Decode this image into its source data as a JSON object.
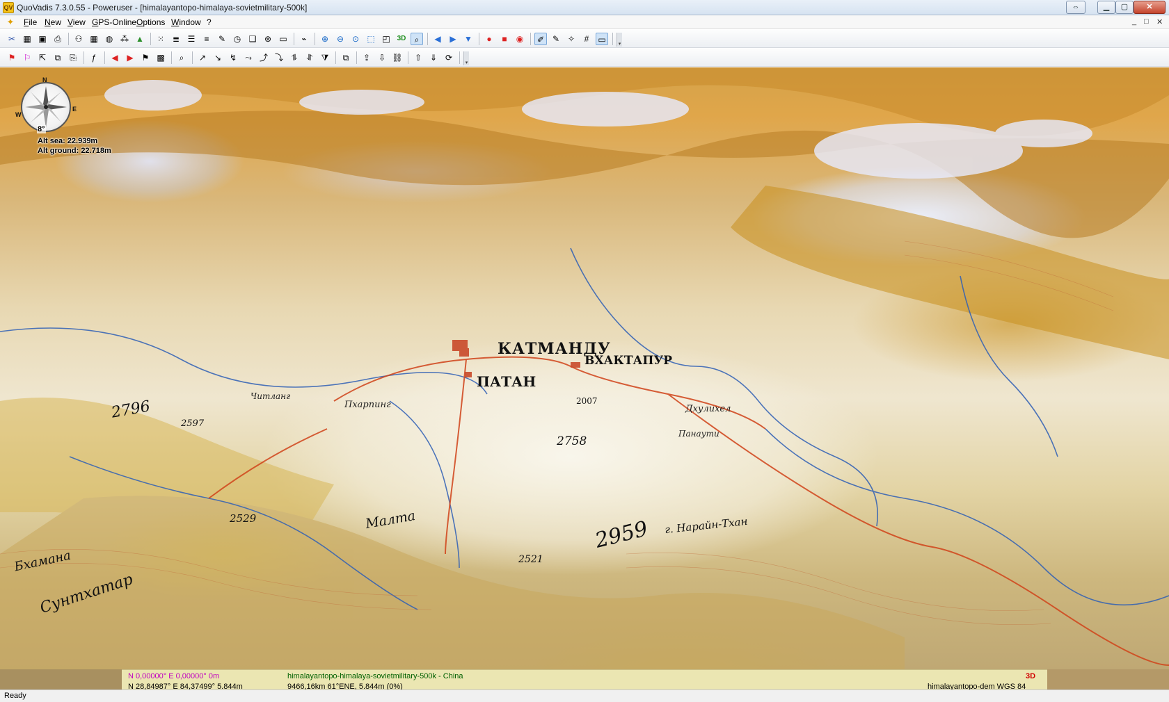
{
  "window": {
    "app_icon": "quovadis-app-icon",
    "title": "QuoVadis 7.3.0.55 - Poweruser - [himalayantopo-himalaya-sovietmilitary-500k]",
    "controls": [
      "restore-alt-icon",
      "minimize-icon",
      "maximize-icon",
      "close-icon"
    ]
  },
  "menubar": {
    "items": [
      "File",
      "New",
      "View",
      "GPS-Online",
      "Options",
      "Window",
      "?"
    ],
    "mdi_controls": [
      "_",
      "□",
      "✕"
    ]
  },
  "toolbar": {
    "row1_icons": [
      "tools-icon",
      "open-map-icon",
      "save-icon",
      "print-icon",
      "binoculars-icon",
      "grid-icon",
      "globe-icon",
      "waypoints-icon",
      "mountain-icon",
      "dots-icon",
      "layers-icon",
      "route-list-icon",
      "track-list-icon",
      "waypoint-edit-icon",
      "clock-icon",
      "book-icon",
      "satellite-icon",
      "ruler-icon",
      "gps-icon",
      "zoom-in-icon",
      "zoom-out-icon",
      "zoom-fit-icon",
      "zoom-rect-icon",
      "3d-view-icon",
      "3d-label-icon",
      "zoom-selected-icon",
      "back-icon",
      "forward-icon",
      "down-icon",
      "record-icon",
      "record-stop-icon",
      "record-pause-icon",
      "draw-icon",
      "pencil-icon",
      "compass-tool-icon",
      "grid-toggle-icon",
      "frame-icon"
    ],
    "row2_icons": [
      "waypoint-new-icon",
      "waypoint-delete-icon",
      "waypoint-move-icon",
      "waypoint-copy-icon",
      "waypoint-paste-icon",
      "script-icon",
      "arrow-left-red-icon",
      "arrow-right-red-icon",
      "flag-icon",
      "color-icon",
      "search-icon",
      "route-add-icon",
      "route-remove-icon",
      "route-split-icon",
      "route-join-icon",
      "track-add-icon",
      "track-remove-icon",
      "track-split-icon",
      "track-join-icon",
      "filter-icon",
      "copy-layer-icon",
      "export-icon",
      "import-icon",
      "link-icon",
      "gps-upload-icon",
      "gps-download-icon",
      "gps-sync-icon"
    ],
    "label_3d": "3D"
  },
  "map": {
    "compass": {
      "n": "N",
      "e": "E",
      "w": "W",
      "heading": "8°"
    },
    "alt_sea": "Alt sea: 22.939m",
    "alt_ground": "Alt ground: 22.718m",
    "labels": {
      "city_main": "КАТМАНДУ",
      "city_patan": "ПАТАН",
      "city_bhaktapur": "ВХАКТАПУР",
      "elev_2758": "2758",
      "elev_2959": "2959",
      "place_marka": "Малта",
      "place_narain": "г. Нарайн-Тхан",
      "place_pharping": "Пхарпинг",
      "place_chitlang": "Читланг",
      "place_dhulikhel": "Дхулихел",
      "place_panauti": "Панаути",
      "place_sukhbatar": "Сунтхатар",
      "place_bakhnia": "Бхамана",
      "elev_2529": "2529",
      "elev_2597": "2597",
      "elev_2007": "2007",
      "elev_2521": "2521",
      "elev_2796": "2796"
    }
  },
  "infobar": {
    "pos_zero": "N 0,00000°  E 0,00000°  0m",
    "map_name": "himalayantopo-himalaya-sovietmilitary-500k - China",
    "mode": "3D",
    "pos_current": "N 28,84987°  E 84,37499°  5.844m",
    "distance": "9466,16km 61°ENE,  5.844m (0%)",
    "dem": "himalayantopo-dem  WGS 84"
  },
  "status": {
    "text": "Ready"
  },
  "colors": {
    "title_bar": "#d6e3f1",
    "toolbar": "#eceff3",
    "infobar": "#ebe6b2",
    "info_pink": "#c000c0",
    "info_green": "#006000",
    "info_red": "#d00000"
  }
}
